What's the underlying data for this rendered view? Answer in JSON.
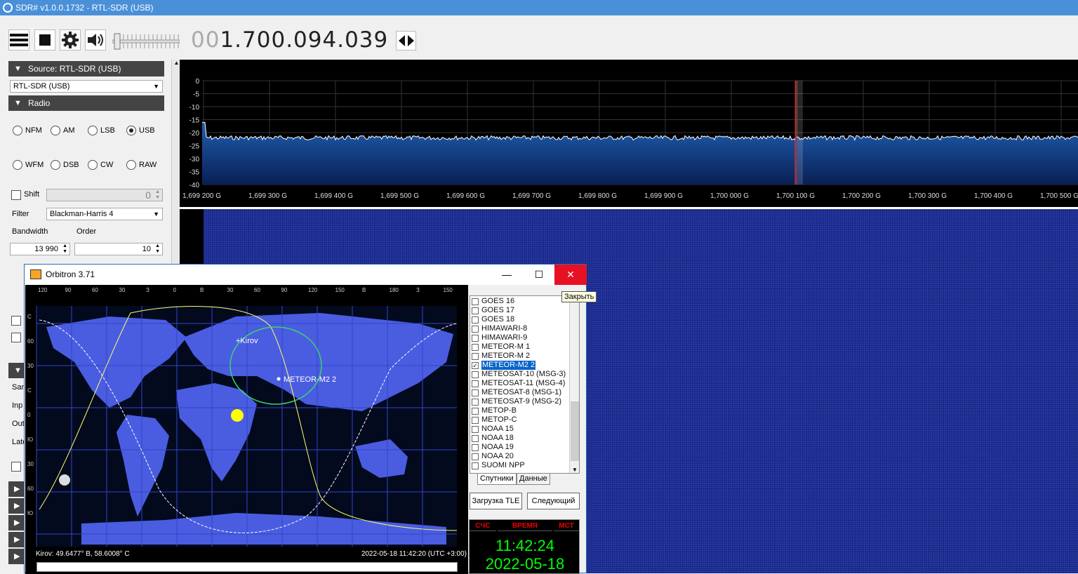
{
  "sdr": {
    "title": "SDR# v1.0.0.1732 - RTL-SDR (USB)",
    "frequency_dim": "00",
    "frequency_main": "1.700.094.039",
    "source_header": "Source: RTL-SDR (USB)",
    "source_device": "RTL-SDR (USB)",
    "radio_header": "Radio",
    "modes": [
      {
        "label": "NFM",
        "selected": false
      },
      {
        "label": "AM",
        "selected": false
      },
      {
        "label": "LSB",
        "selected": false
      },
      {
        "label": "USB",
        "selected": true
      },
      {
        "label": "WFM",
        "selected": false
      },
      {
        "label": "DSB",
        "selected": false
      },
      {
        "label": "CW",
        "selected": false
      },
      {
        "label": "RAW",
        "selected": false
      }
    ],
    "shift_label": "Shift",
    "shift_value": "0",
    "filter_label": "Filter",
    "filter_value": "Blackman-Harris 4",
    "bandwidth_label": "Bandwidth",
    "order_label": "Order",
    "bandwidth_value": "13 990",
    "order_value": "10",
    "partial_labels": [
      "Sam",
      "Inp",
      "Out",
      "Late"
    ]
  },
  "spectrum": {
    "y_ticks": [
      "0",
      "-5",
      "-10",
      "-15",
      "-20",
      "-25",
      "-30",
      "-35",
      "-40"
    ],
    "x_ticks": [
      "1,699 200 G",
      "1,699 300 G",
      "1,699 400 G",
      "1,699 500 G",
      "1,699 600 G",
      "1,699 700 G",
      "1,699 800 G",
      "1,699 900 G",
      "1,700 000 G",
      "1,700 100 G",
      "1,700 200 G",
      "1,700 300 G",
      "1,700 400 G",
      "1,700 500 G"
    ],
    "noise_floor_db": -22,
    "colors": {
      "background": "#000000",
      "trace": "#ffffff",
      "fill": "#1e5fae",
      "marker": "#cc2222",
      "waterfall": "#1a2a8c"
    }
  },
  "orbitron": {
    "title": "Orbitron 3.71",
    "tooltip": "Закрыть",
    "top_scale": [
      "120",
      "90",
      "60",
      "30",
      "З",
      "0",
      "В",
      "30",
      "60",
      "90",
      "120",
      "150",
      "В",
      "180",
      "З",
      "150"
    ],
    "left_scale": [
      "С",
      "60",
      "30",
      "С",
      "0",
      "Ю",
      "30",
      "60",
      "Ю"
    ],
    "map_label_city": "+Kirov",
    "map_label_sat": "METEOR-M2 2",
    "status_left": "Kirov: 49.6477° В, 58.6008° С",
    "status_right": "2022-05-18 11:42:20 (UTC +3:00)",
    "satellites": [
      {
        "name": "GOES 16",
        "checked": false
      },
      {
        "name": "GOES 17",
        "checked": false
      },
      {
        "name": "GOES 18",
        "checked": false
      },
      {
        "name": "HIMAWARI-8",
        "checked": false
      },
      {
        "name": "HIMAWARI-9",
        "checked": false
      },
      {
        "name": "METEOR-M 1",
        "checked": false
      },
      {
        "name": "METEOR-M 2",
        "checked": false
      },
      {
        "name": "METEOR-M2 2",
        "checked": true
      },
      {
        "name": "METEOSAT-10 (MSG-3)",
        "checked": false
      },
      {
        "name": "METEOSAT-11 (MSG-4)",
        "checked": false
      },
      {
        "name": "METEOSAT-8 (MSG-1)",
        "checked": false
      },
      {
        "name": "METEOSAT-9 (MSG-2)",
        "checked": false
      },
      {
        "name": "METOP-B",
        "checked": false
      },
      {
        "name": "METOP-C",
        "checked": false
      },
      {
        "name": "NOAA 15",
        "checked": false
      },
      {
        "name": "NOAA 18",
        "checked": false
      },
      {
        "name": "NOAA 19",
        "checked": false
      },
      {
        "name": "NOAA 20",
        "checked": false
      },
      {
        "name": "SUOMI NPP",
        "checked": false
      }
    ],
    "tab_satellites": "Спутники",
    "tab_data": "Данные",
    "btn_load_tle": "Загрузка TLE",
    "btn_next": "Следующий",
    "clock_heads": [
      "СЧС",
      "ВРЕМЯ",
      "МСТ"
    ],
    "clock_time": "11:42:24",
    "clock_date": "2022-05-18"
  }
}
